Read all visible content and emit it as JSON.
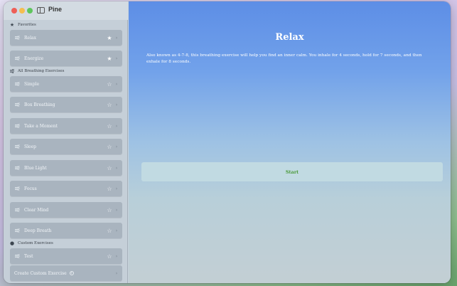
{
  "app": {
    "title": "Pine"
  },
  "sidebar": {
    "favorites_header": "Favorites",
    "favorites": [
      {
        "label": "Relax",
        "starred": true
      },
      {
        "label": "Energize",
        "starred": true
      }
    ],
    "all_header": "All Breathing Exercises",
    "all": [
      {
        "label": "Simple",
        "starred": false
      },
      {
        "label": "Box Breathing",
        "starred": false
      },
      {
        "label": "Take a Moment",
        "starred": false
      },
      {
        "label": "Sleep",
        "starred": false
      },
      {
        "label": "Blue Light",
        "starred": false
      },
      {
        "label": "Focus",
        "starred": false
      },
      {
        "label": "Clear Mind",
        "starred": false
      },
      {
        "label": "Deep Breath",
        "starred": false
      }
    ],
    "custom_header": "Custom Exercises",
    "custom": [
      {
        "label": "Test",
        "starred": false
      }
    ],
    "create_label": "Create Custom Exercise"
  },
  "main": {
    "title": "Relax",
    "description": "Also known as 4-7-8, this breathing exercise will help you find an inner calm. You inhale for 4 seconds, hold for 7 seconds, and then exhale for 8 seconds.",
    "start_label": "Start"
  },
  "colors": {
    "start_text": "#4b9a3a",
    "row_bg": "#a9b4bf",
    "main_top": "#5d8ee6"
  }
}
